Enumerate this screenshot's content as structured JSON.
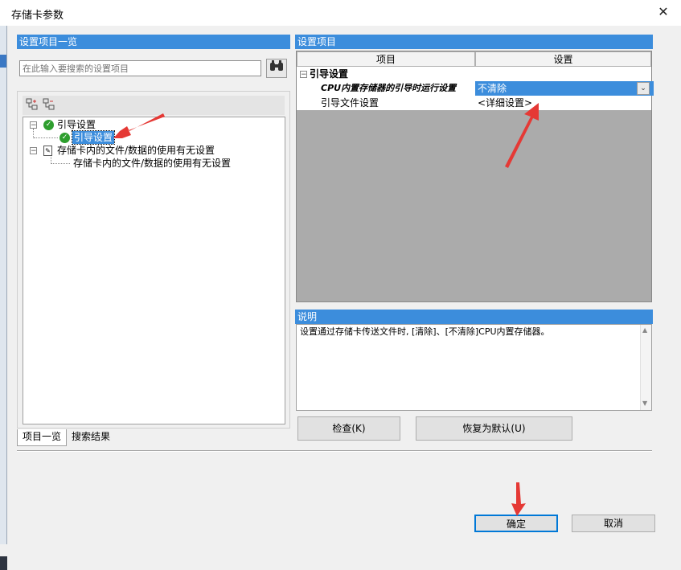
{
  "window": {
    "title": "存储卡参数",
    "close_glyph": "✕"
  },
  "left_panel": {
    "header": "设置项目一览",
    "search_placeholder": "在此输入要搜索的设置项目",
    "search_icon": "binoculars-icon",
    "toolbar": {
      "expand_icon": "expand-all-icon",
      "collapse_icon": "collapse-all-icon"
    },
    "tree": [
      {
        "label": "引导设置",
        "children": [
          {
            "label": "引导设置",
            "selected": true
          }
        ]
      },
      {
        "label": "存储卡内的文件/数据的使用有无设置",
        "children": [
          {
            "label": "存储卡内的文件/数据的使用有无设置"
          }
        ]
      }
    ],
    "tabs": [
      "项目一览",
      "搜索结果"
    ]
  },
  "right_panel": {
    "header": "设置项目",
    "columns": [
      "项目",
      "设置"
    ],
    "group": "引导设置",
    "rows": [
      {
        "item": "CPU内置存储器的引导时运行设置",
        "value": "不清除",
        "has_dropdown": true
      },
      {
        "item": "引导文件设置",
        "value": "<详细设置>"
      }
    ]
  },
  "description": {
    "header": "说明",
    "text": "设置通过存储卡传送文件时, [清除]、[不清除]CPU内置存储器。"
  },
  "buttons": {
    "check": "检查(K)",
    "default": "恢复为默认(U)",
    "ok": "确定",
    "cancel": "取消"
  },
  "colors": {
    "accent": "#3c8ddc",
    "annotation_arrow": "#e53935",
    "check_green": "#2e9e2e"
  }
}
